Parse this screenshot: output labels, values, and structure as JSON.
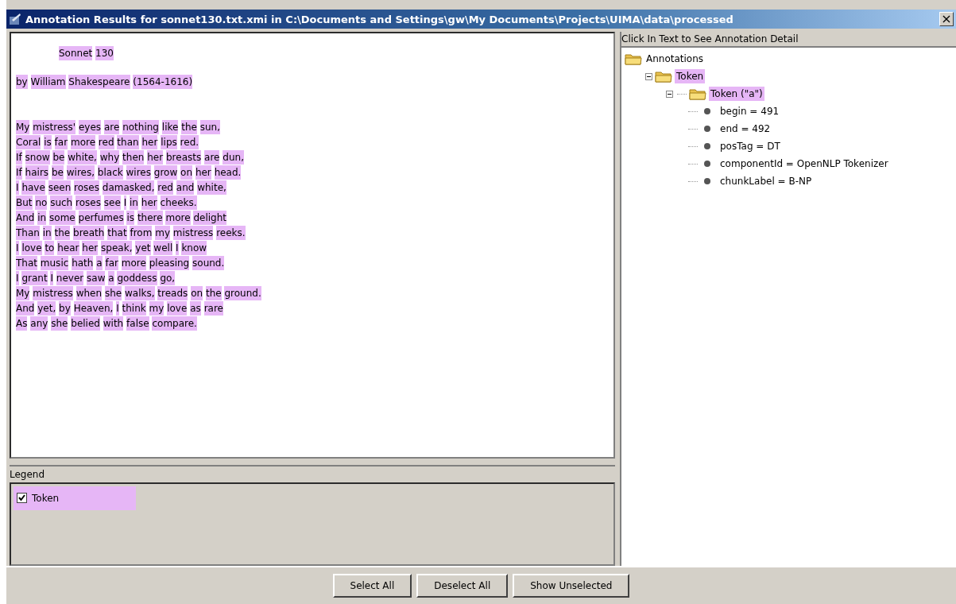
{
  "window": {
    "title": "Annotation Results for sonnet130.txt.xmi in C:\\Documents and Settings\\gw\\My Documents\\Projects\\UIMA\\data\\processed",
    "close": "×"
  },
  "text_view": {
    "paragraphs": [
      {
        "kind": "title",
        "lines": [
          "Sonnet 130"
        ]
      },
      {
        "kind": "byline",
        "lines": [
          "by William Shakespeare (1564-1616)"
        ]
      },
      {
        "kind": "verse",
        "lines": [
          "My mistress' eyes are nothing like the sun,",
          "Coral is far more red than her lips red.",
          "If snow be white, why then her breasts are dun,",
          "If hairs be wires, black wires grow on her head.",
          "I have seen roses damasked, red and white,",
          "But no such roses see I in her cheeks.",
          "And in some perfumes is there more delight",
          "Than in the breath that from my mistress reeks.",
          "I love to hear her speak, yet well I know",
          "That music hath a far more pleasing sound.",
          "I grant I never saw a goddess go,",
          "My mistress when she walks, treads on the ground.",
          "And yet, by Heaven, I think my love as rare",
          "As any she belied with false compare."
        ]
      }
    ]
  },
  "legend": {
    "title": "Legend",
    "items": [
      {
        "label": "Token",
        "checked": true,
        "color": "#e6b6f6"
      }
    ]
  },
  "detail": {
    "title": "Click In Text to See Annotation Detail",
    "tree": [
      {
        "label": "Annotations",
        "kind": "folder",
        "children": [
          {
            "label": "Token",
            "kind": "folder",
            "expanded": true,
            "selected": true,
            "children": [
              {
                "label": "Token (\"a\")",
                "kind": "folder",
                "expanded": true,
                "selected": true,
                "children": [
                  {
                    "label": "begin = 491",
                    "kind": "leaf",
                    "selected": false
                  },
                  {
                    "label": "end = 492",
                    "kind": "leaf",
                    "selected": false
                  },
                  {
                    "label": "posTag = DT",
                    "kind": "leaf",
                    "selected": false
                  },
                  {
                    "label": "componentId = OpenNLP Tokenizer",
                    "kind": "leaf",
                    "selected": false
                  },
                  {
                    "label": "chunkLabel = B-NP",
                    "kind": "leaf",
                    "selected": false
                  }
                ]
              }
            ]
          }
        ]
      }
    ]
  },
  "buttons": [
    "Select All",
    "Deselect All",
    "Show Unselected"
  ]
}
